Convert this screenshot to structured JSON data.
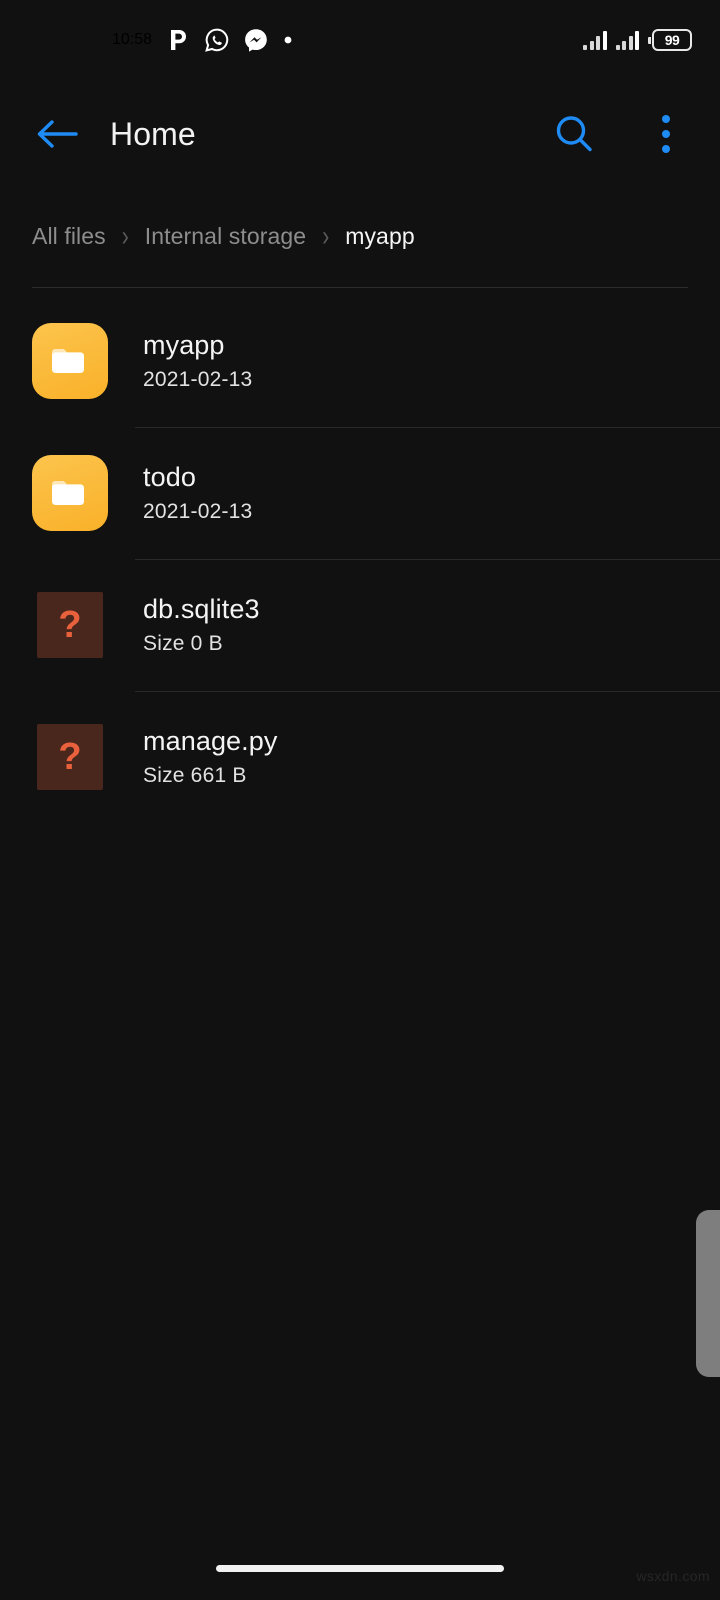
{
  "status_bar": {
    "clock": "10:58",
    "notification_icons": [
      {
        "name": "p-app-icon",
        "glyph": "p"
      },
      {
        "name": "whatsapp-icon",
        "glyph": "whatsapp"
      },
      {
        "name": "messenger-icon",
        "glyph": "messenger"
      },
      {
        "name": "more-notifications-dot",
        "glyph": "dot"
      }
    ],
    "signal_sim1": "signal-bars-icon",
    "signal_sim2": "signal-bars-icon",
    "battery_icon": "battery-icon",
    "battery_level": "99"
  },
  "app_bar": {
    "back_icon": "back-arrow-icon",
    "title": "Home",
    "search_icon": "search-icon",
    "overflow_icon": "overflow-menu-icon",
    "accent_color": "#1f8bf5"
  },
  "breadcrumb": {
    "separator": "›",
    "items": [
      {
        "label": "All files",
        "current": false
      },
      {
        "label": "Internal storage",
        "current": false
      },
      {
        "label": "myapp",
        "current": true
      }
    ]
  },
  "file_list": {
    "rows": [
      {
        "name": "myapp",
        "meta": "2021-02-13",
        "icon": "folder-icon",
        "kind": "folder"
      },
      {
        "name": "todo",
        "meta": "2021-02-13",
        "icon": "folder-icon",
        "kind": "folder"
      },
      {
        "name": "db.sqlite3",
        "meta": "Size 0 B",
        "icon": "unknown-file-icon",
        "kind": "file",
        "glyph": "?"
      },
      {
        "name": "manage.py",
        "meta": "Size 661 B",
        "icon": "unknown-file-icon",
        "kind": "file",
        "glyph": "?"
      }
    ]
  },
  "scrollbar": {
    "name": "scrollbar-thumb"
  },
  "bottom": {
    "gesture_bar": "home-gesture-bar",
    "watermark": "wsxdn.com"
  },
  "colors": {
    "background": "#111111",
    "accent_blue": "#1f8bf5",
    "folder_amber": "#f9b129",
    "unknown_icon_bg": "#4a271d",
    "unknown_icon_fg": "#e8613c",
    "divider": "#2a2a2a"
  }
}
